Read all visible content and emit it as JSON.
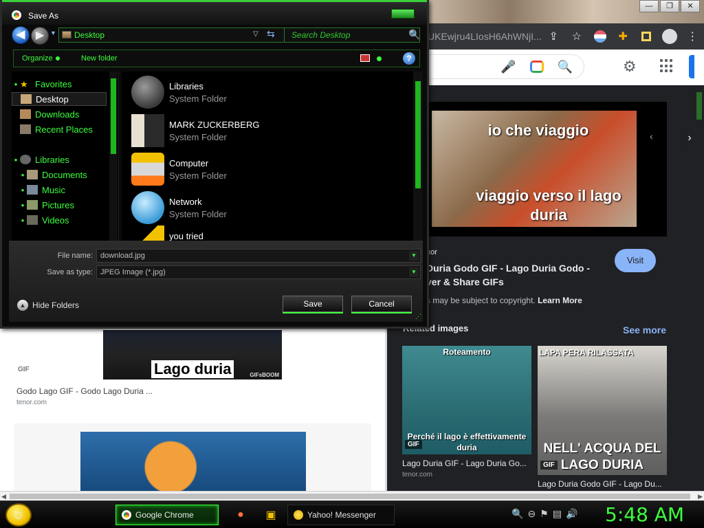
{
  "browser": {
    "url_fragment": "UKEwjru4LIosH6AhWNjI...",
    "window_controls": [
      "—",
      "❐",
      "✕"
    ],
    "toolbar_icons": [
      "share-icon",
      "star-icon",
      "flag-extension-icon",
      "puzzle-extension-icon",
      "sidebar-icon",
      "profile-icon",
      "menu-icon"
    ],
    "share_glyph": "⇪",
    "star_glyph": "☆",
    "puzzle_glyph": "✚",
    "menu_glyph": "⋮",
    "mic_glyph": "🎤",
    "magnify_glyph": "🔍",
    "gear_glyph": "⚙"
  },
  "results": {
    "result1": {
      "image_caption": "Lago duria",
      "image_logo": "GIFsBOOM",
      "badge": "GIF",
      "title": "Godo Lago GIF - Godo Lago Duria ...",
      "source": "tenor.com"
    }
  },
  "preview": {
    "caption_top": "io che viaggio",
    "caption_bottom": "viaggio verso il lago duria",
    "prev_glyph": "‹",
    "next_glyph": "›",
    "source_name": "nor",
    "title": "Duria Godo GIF - Lago Duria Godo - ver & Share GIFs",
    "visit_label": "Visit",
    "copyright_text": "s may be subject to copyright.",
    "learn_more": "Learn More",
    "related_title": "Related images",
    "see_more": "See more",
    "related": [
      {
        "image_top": "Roteamento",
        "image_bottom": "Perché il lago è effettivamente duria",
        "badge": "GIF",
        "title": "Lago Duria GIF - Lago Duria Go...",
        "source": "tenor.com"
      },
      {
        "image_top": "LAPA PERA RILASSATA",
        "image_bottom": "NELL' ACQUA DEL LAGO DURIA",
        "badge": "GIF",
        "title": "Lago Duria Godo GIF - Lago Du..."
      }
    ]
  },
  "scrollbar": {
    "left_arrow": "◀",
    "right_arrow": "▶"
  },
  "dialog": {
    "title": "Save As",
    "address": "Desktop",
    "search_placeholder": "Search Desktop",
    "nav_back_glyph": "◀",
    "nav_forward_glyph": "▶",
    "hist_glyph": "▼",
    "dropdown_glyph": "▽",
    "refresh_glyph": "⇆",
    "search_glyph": "🔍",
    "toolbar": {
      "organize": "Organize",
      "new_folder": "New folder",
      "help_glyph": "?"
    },
    "nav": {
      "favorites": "Favorites",
      "desktop": "Desktop",
      "downloads": "Downloads",
      "recent_places": "Recent Places",
      "libraries": "Libraries",
      "documents": "Documents",
      "music": "Music",
      "pictures": "Pictures",
      "videos": "Videos",
      "bullet": "●",
      "star_glyph": "★"
    },
    "files": [
      {
        "name": "Libraries",
        "type": "System Folder"
      },
      {
        "name": "MARK ZUCKERBERG",
        "type": "System Folder"
      },
      {
        "name": "Computer",
        "type": "System Folder"
      },
      {
        "name": "Network",
        "type": "System Folder"
      },
      {
        "name": "you tried",
        "type": ""
      }
    ],
    "form": {
      "file_name_label": "File name:",
      "file_name_value": "download.jpg",
      "save_type_label": "Save as type:",
      "save_type_value": "JPEG Image (*.jpg)",
      "arrow_glyph": "▼",
      "hide_folders": "Hide Folders",
      "hide_glyph": "▲",
      "save": "Save",
      "cancel": "Cancel",
      "grip_glyph": "⋰"
    }
  },
  "taskbar": {
    "start_glyph": "☺",
    "chrome_label": "Google Chrome",
    "firefox_glyph": "●",
    "explorer_glyph": "▣",
    "yahoo_label": "Yahoo! Messenger",
    "tray": [
      "🔍",
      "⊖",
      "⚑",
      "▤",
      "🔊"
    ],
    "clock": "5:48 AM"
  },
  "colors": {
    "accent_green": "#3cff3c",
    "google_blue": "#8ab4f8",
    "dark_bg": "#202124"
  }
}
